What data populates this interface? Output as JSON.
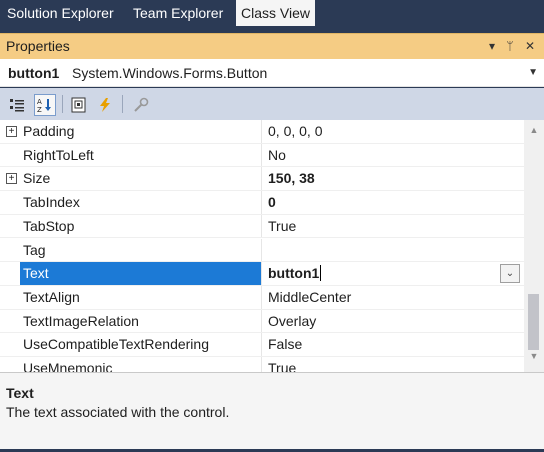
{
  "tabs": [
    {
      "label": "Solution Explorer",
      "active": false
    },
    {
      "label": "Team Explorer",
      "active": false
    },
    {
      "label": "Class View",
      "active": true
    }
  ],
  "panel": {
    "title": "Properties",
    "controls": {
      "dropdown": "▾",
      "pin": "ᛘ",
      "close": "✕"
    }
  },
  "object": {
    "name": "button1",
    "type": "System.Windows.Forms.Button"
  },
  "toolbar": {
    "icons": [
      "categorized-icon",
      "alphabetical-icon",
      "property-pages-icon",
      "events-icon",
      "settings-wrench-icon"
    ],
    "selected": "alphabetical-icon"
  },
  "properties": [
    {
      "name": "Padding",
      "value": "0, 0, 0, 0",
      "expandable": true,
      "bold": false
    },
    {
      "name": "RightToLeft",
      "value": "No",
      "expandable": false,
      "bold": false
    },
    {
      "name": "Size",
      "value": "150, 38",
      "expandable": true,
      "bold": true
    },
    {
      "name": "TabIndex",
      "value": "0",
      "expandable": false,
      "bold": true
    },
    {
      "name": "TabStop",
      "value": "True",
      "expandable": false,
      "bold": false
    },
    {
      "name": "Tag",
      "value": "",
      "expandable": false,
      "bold": false
    },
    {
      "name": "Text",
      "value": "button1",
      "expandable": false,
      "bold": true,
      "selected": true
    },
    {
      "name": "TextAlign",
      "value": "MiddleCenter",
      "expandable": false,
      "bold": false
    },
    {
      "name": "TextImageRelation",
      "value": "Overlay",
      "expandable": false,
      "bold": false
    },
    {
      "name": "UseCompatibleTextRendering",
      "value": "False",
      "expandable": false,
      "bold": false
    },
    {
      "name": "UseMnemonic",
      "value": "True",
      "expandable": false,
      "bold": false
    }
  ],
  "description": {
    "title": "Text",
    "text": "The text associated with the control."
  },
  "colors": {
    "selection": "#1c7ad6",
    "header": "#f5cc84",
    "frame": "#2b3a55",
    "toolbar": "#cfd7e6"
  }
}
